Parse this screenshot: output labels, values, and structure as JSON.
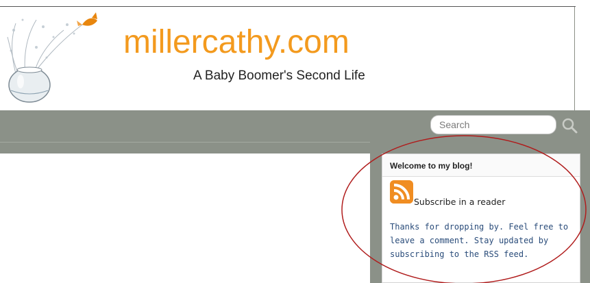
{
  "header": {
    "title": "millercathy.com",
    "tagline": "A Baby Boomer's Second Life"
  },
  "search": {
    "placeholder": "Search",
    "value": ""
  },
  "widget": {
    "title": "Welcome to my blog!",
    "subscribe_label": "Subscribe in a reader",
    "text": "Thanks for dropping by. Feel free to leave a comment. Stay updated by subscribing to the RSS feed."
  },
  "colors": {
    "brand_orange": "#f39a1e",
    "nav_gray": "#8b9188",
    "annotation_red": "#b01c1c",
    "link_blue": "#2a4c7a"
  },
  "icons": [
    "fishbowl-logo-icon",
    "search-icon",
    "rss-icon"
  ]
}
